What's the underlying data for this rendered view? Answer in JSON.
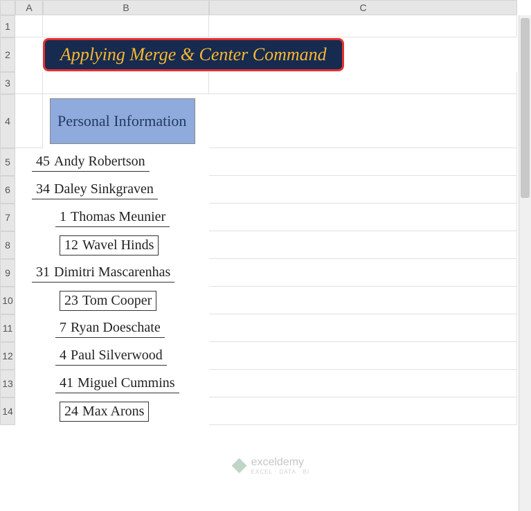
{
  "columns": {
    "A": "A",
    "B": "B",
    "C": "C"
  },
  "rows": [
    "1",
    "2",
    "3",
    "4",
    "5",
    "6",
    "7",
    "8",
    "9",
    "10",
    "11",
    "12",
    "13",
    "14"
  ],
  "title": "Applying Merge & Center Command",
  "section_header": "Personal Information",
  "data": [
    {
      "num": "45",
      "name": "Andy Robertson",
      "boxed": false,
      "indent": "sm"
    },
    {
      "num": "34",
      "name": "Daley Sinkgraven",
      "boxed": false,
      "indent": "sm"
    },
    {
      "num": "1",
      "name": "Thomas Meunier",
      "boxed": false,
      "indent": "md"
    },
    {
      "num": "12",
      "name": "Wavel Hinds",
      "boxed": true,
      "indent": "lg"
    },
    {
      "num": "31",
      "name": "Dimitri Mascarenhas",
      "boxed": false,
      "indent": "sm"
    },
    {
      "num": "23",
      "name": "Tom Cooper",
      "boxed": true,
      "indent": "lg"
    },
    {
      "num": "7",
      "name": "Ryan Doeschate",
      "boxed": false,
      "indent": "md"
    },
    {
      "num": "4",
      "name": "Paul Silverwood",
      "boxed": false,
      "indent": "md"
    },
    {
      "num": "41",
      "name": "Miguel Cummins",
      "boxed": false,
      "indent": "md"
    },
    {
      "num": "24",
      "name": "Max Arons",
      "boxed": true,
      "indent": "lg"
    }
  ],
  "watermark": {
    "text": "exceldemy",
    "sub": "EXCEL · DATA · BI"
  }
}
